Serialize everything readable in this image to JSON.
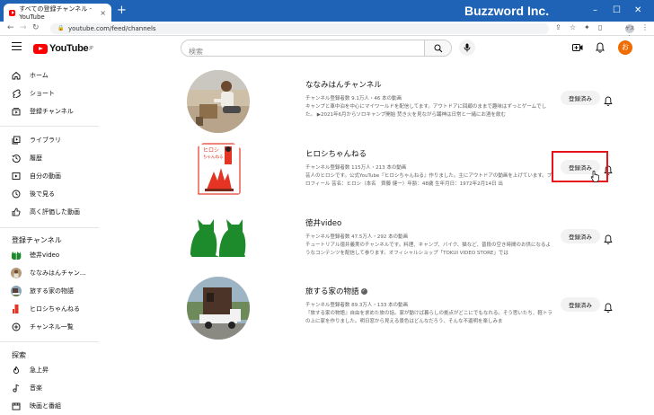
{
  "browser": {
    "tab_title": "すべての登録チャンネル - YouTube",
    "tab_close": "×",
    "new_tab": "+",
    "brand": "Buzzword Inc.",
    "url": "youtube.com/feed/channels",
    "profile": "ゲスト",
    "controls": {
      "minimize": "–",
      "maximize": "☐",
      "close": "✕"
    }
  },
  "header": {
    "logo_text": "YouTube",
    "logo_sup": "JP",
    "search_placeholder": "検索",
    "user_initial": "お"
  },
  "sidebar": {
    "main": [
      {
        "label": "ホーム",
        "icon": "home-icon"
      },
      {
        "label": "ショート",
        "icon": "shorts-icon"
      },
      {
        "label": "登録チャンネル",
        "icon": "subscriptions-icon"
      }
    ],
    "library": [
      {
        "label": "ライブラリ",
        "icon": "library-icon"
      },
      {
        "label": "履歴",
        "icon": "history-icon"
      },
      {
        "label": "自分の動画",
        "icon": "my-videos-icon"
      },
      {
        "label": "後で見る",
        "icon": "watch-later-icon"
      },
      {
        "label": "高く評価した動画",
        "icon": "liked-icon"
      }
    ],
    "subs_heading": "登録チャンネル",
    "subs": [
      {
        "label": "徳井video",
        "avatar": "tokui"
      },
      {
        "label": "ななみはんチャン...",
        "avatar": "nanami"
      },
      {
        "label": "旅する家の物語",
        "avatar": "tabi"
      },
      {
        "label": "ヒロシちゃんねる",
        "avatar": "hiroshi"
      },
      {
        "label": "チャンネル一覧",
        "icon": "add-circle-icon"
      }
    ],
    "explore_heading": "探索",
    "explore": [
      {
        "label": "急上昇",
        "icon": "trending-icon"
      },
      {
        "label": "音楽",
        "icon": "music-icon"
      },
      {
        "label": "映画と番組",
        "icon": "movies-icon"
      }
    ]
  },
  "channels": [
    {
      "name": "ななみはんチャンネル",
      "meta": "チャンネル登録者数 9.1万人・46 本の動画",
      "desc": "キャンプと車中泊を中心にマイワールドを配信してます。アウトドアに回顧のままで趣味はずっとゲームでした。 ▶2021年6月からソロキャンプ開始 焚き火を見ながら踊神は日常と一緒にお酒を飲む",
      "button": "登録済み",
      "verified": false
    },
    {
      "name": "ヒロシちゃんねる",
      "meta": "チャンネル登録者数 115万人・213 本の動画",
      "desc": "芸人のヒロシです。公式YouTube『ヒロシちゃんねる』作りました。主にアウトドアの動画を上げています。プロフィール 芸名：ヒロシ（本名　齊藤 健一）年齢：48歳 生年月日：1972年2月14日 出",
      "button": "登録済み",
      "verified": false,
      "logo_text": "ヒロシ ちゃんねる"
    },
    {
      "name": "徳井video",
      "meta": "チャンネル登録者数 47.5万人・292 本の動画",
      "desc": "チュートリアル徳井義実のチャンネルです。料理、キャンプ、バイク、猫など、普段の空き時間のお供になるようなコンテンツを配信して参ります。オフィシャルショップ「TOKUI VIDEO STORE」では",
      "button": "登録済み",
      "verified": false
    },
    {
      "name": "旅する家の物語",
      "meta": "チャンネル登録者数 89.3万人・133 本の動画",
      "desc": "『旅する家の物語』自由を求めた旅の話。家が動けば暮らしの拠点がどこにでもなれる。そう思いたち、軽トラの上に家を作りました。明日窓から見える景色はどんなだろう、そんな不還明を楽しみま",
      "button": "登録済み",
      "verified": true
    }
  ],
  "colors": {
    "accent_red": "#ff0000",
    "highlight_border": "#e8141c",
    "tab_bar": "#1f63b7"
  }
}
